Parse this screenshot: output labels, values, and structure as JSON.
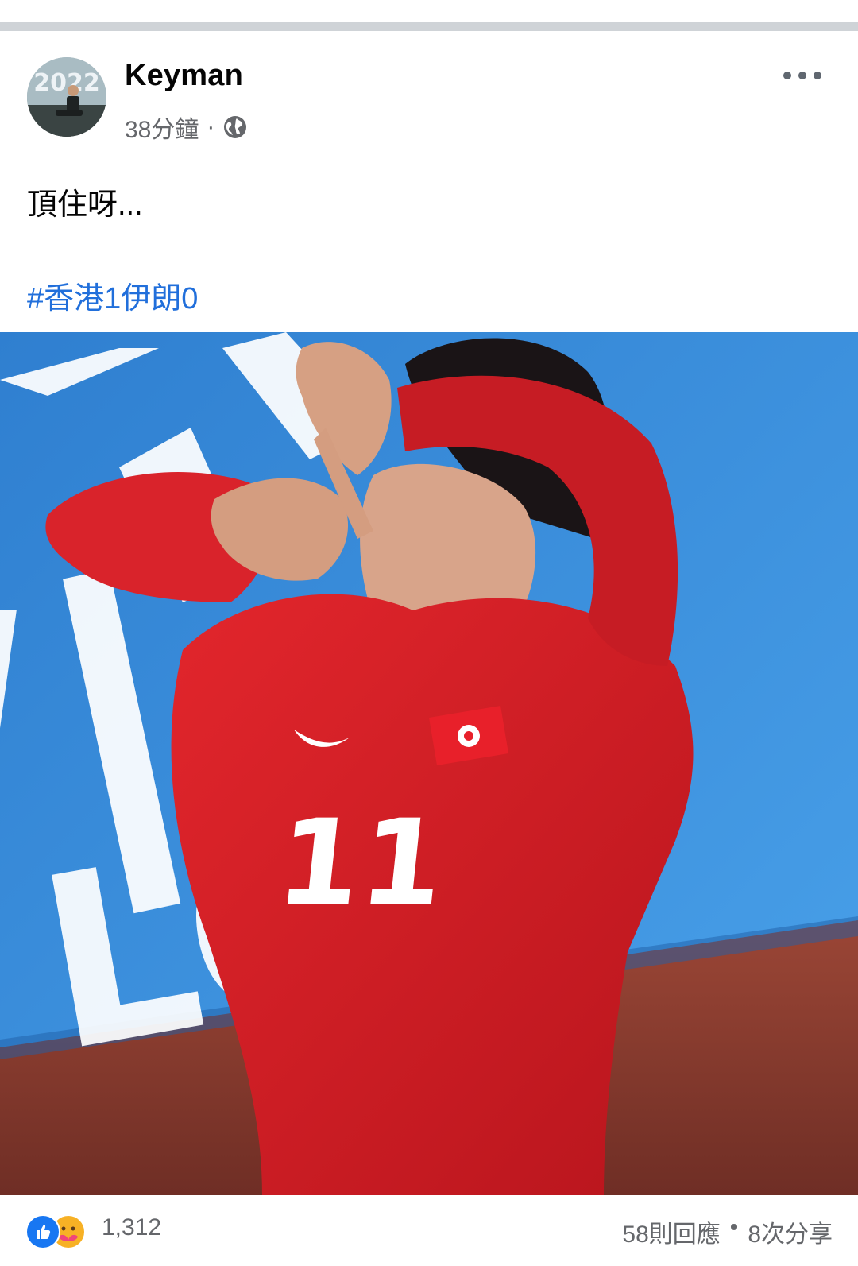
{
  "post": {
    "author": "Keyman",
    "time": "38分鐘",
    "meta_separator": "·",
    "privacy_icon": "globe-icon",
    "text": "頂住呀...",
    "hashtag": "#香港1伊朗0",
    "photo": {
      "jersey_number": "11",
      "board_text": "LO"
    },
    "reactions": {
      "count": "1,312",
      "icons": [
        "like-icon",
        "care-icon"
      ]
    },
    "comments": "58則回應",
    "separator": "•",
    "shares": "8次分享"
  },
  "colors": {
    "link": "#216fdb",
    "secondary_text": "#65676b",
    "like_blue": "#1877f2",
    "jersey_red": "#d9202a",
    "board_blue": "#3b8ed9"
  }
}
